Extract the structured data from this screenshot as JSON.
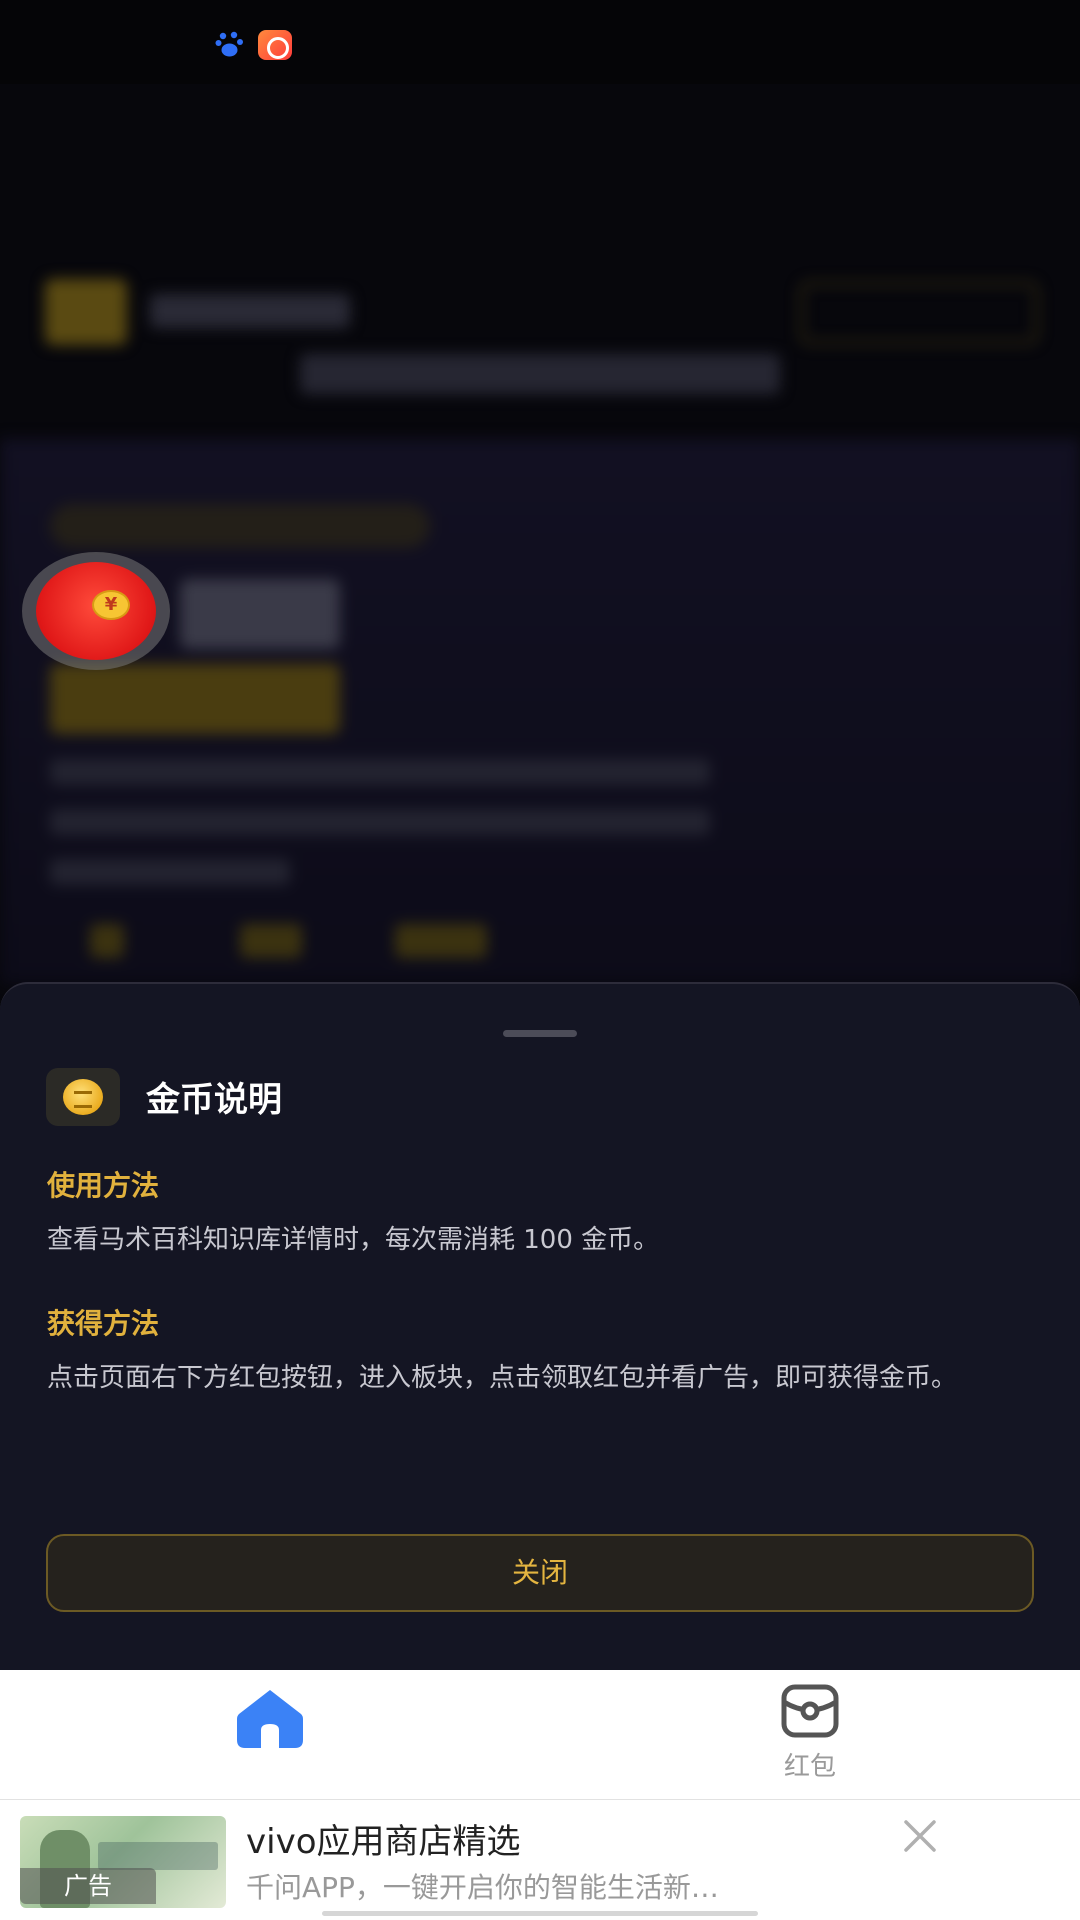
{
  "status_bar": {
    "icons": [
      "baidu-icon",
      "kuaishou-icon"
    ]
  },
  "floating_button": {
    "icon": "red-packet-icon",
    "coin_symbol": "¥"
  },
  "sheet": {
    "title": "金币说明",
    "header_icon": "gold-coin-icon",
    "sections": [
      {
        "title": "使用方法",
        "text": "查看马术百科知识库详情时，每次需消耗 100 金币。"
      },
      {
        "title": "获得方法",
        "text": "点击页面右下方红包按钮，进入板块，点击领取红包并看广告，即可获得金币。"
      }
    ],
    "close_label": "关闭"
  },
  "tab_bar": {
    "items": [
      {
        "icon": "home-icon",
        "label": "",
        "active": true
      },
      {
        "icon": "red-packet-tab-icon",
        "label": "红包",
        "active": false
      }
    ],
    "active_color": "#3b82f6"
  },
  "ad": {
    "badge": "广告",
    "title": "vivo应用商店精选",
    "subtitle": "千问APP，一键开启你的智能生活新…"
  },
  "colors": {
    "accent_gold": "#e1b13d",
    "sheet_bg": "#141523",
    "page_bg": "#07070c"
  }
}
